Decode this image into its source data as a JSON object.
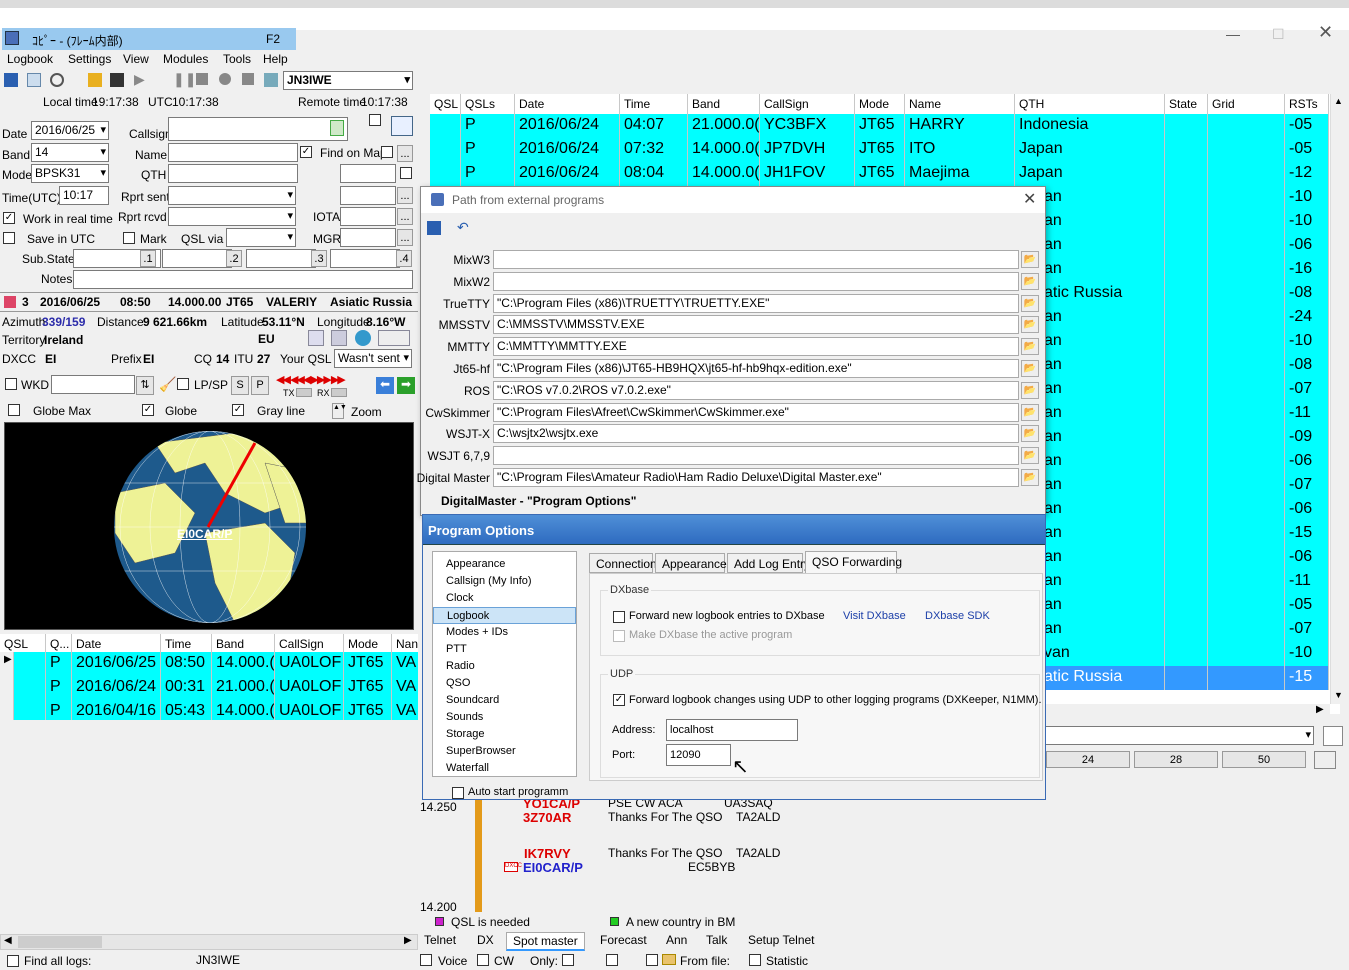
{
  "window": {
    "title_jp": "ｺﾋﾟｰ - (ﾌﾚｰﾑ内部)",
    "hotkey": "F2"
  },
  "menu": [
    "Logbook",
    "Settings",
    "View",
    "Modules",
    "Tools",
    "Help"
  ],
  "toolbar": {
    "callsign": "JN3IWE"
  },
  "time": {
    "local_label": "Local time",
    "local": "19:17:38",
    "utc_label": "UTC",
    "utc": "10:17:38",
    "remote_label": "Remote time",
    "remote": "10:17:38"
  },
  "form": {
    "date_label": "Date",
    "date": "2016/06/25",
    "band_label": "Band",
    "band": "14",
    "mode_label": "Mode",
    "mode": "BPSK31",
    "time_label": "Time(UTC)",
    "time": "10:17",
    "work_realtime": "Work in real time",
    "save_utc": "Save in UTC",
    "substate": "Sub.State:",
    "notes": "Notes",
    "callsign_label": "Callsign",
    "name_label": "Name",
    "qth_label": "QTH",
    "rprt_sent": "Rprt sent",
    "rprt_rcvd": "Rprt rcvd",
    "mark": "Mark",
    "qsl_via": "QSL via",
    "find_on_map": "Find on Map",
    "grid": "Grid",
    "state": "State",
    "iota": "IOTA",
    "mgr": "MGR",
    "sub_buttons": [
      ".1",
      ".2",
      ".3",
      ".4"
    ]
  },
  "info": {
    "count": "3",
    "date": "2016/06/25",
    "time": "08:50",
    "freq": "14.000.00",
    "mode": "JT65",
    "name": "VALERIY",
    "region": "Asiatic Russia",
    "azimuth_label": "Azimuth",
    "azimuth": "339/159",
    "distance_label": "Distance",
    "distance": "9 621.66km",
    "latitude_label": "Latitude",
    "latitude": "53.11°N",
    "longitude_label": "Longitude",
    "longitude": "8.16°W",
    "territory_label": "Territory",
    "territory": "Ireland",
    "continent": "EU",
    "dxcc_label": "DXCC",
    "dxcc": "EI",
    "prefix_label": "Prefix",
    "prefix": "EI",
    "cq_label": "CQ",
    "cq": "14",
    "itu_label": "ITU",
    "itu": "27",
    "your_qsl_label": "Your QSL",
    "your_qsl": "Wasn't sent"
  },
  "wkd": {
    "label": "WKD",
    "lpsp": "LP/SP",
    "s": "S",
    "p": "P",
    "tx": "TX",
    "rx": "RX"
  },
  "globe": {
    "globe_max": "Globe Max",
    "globe": "Globe",
    "grayline": "Gray line",
    "zoom": "Zoom",
    "station": "EI0CAR/P"
  },
  "bottom_grid": {
    "headers": [
      "QSL",
      "Q...",
      "Date",
      "Time",
      "Band",
      "CallSign",
      "Mode",
      "Nan"
    ],
    "rows": [
      [
        "P",
        "2016/06/25",
        "08:50",
        "14.000.(",
        "UA0LOF",
        "JT65",
        "VA"
      ],
      [
        "P",
        "2016/06/24",
        "00:31",
        "21.000.(",
        "UA0LOF",
        "JT65",
        "VA"
      ],
      [
        "P",
        "2016/04/16",
        "05:43",
        "14.000.(",
        "UA0LOF",
        "JT65",
        "VA"
      ]
    ]
  },
  "main_grid": {
    "headers": [
      "QSL",
      "QSLs",
      "Date",
      "Time",
      "Band",
      "CallSign",
      "Mode",
      "Name",
      "QTH",
      "State",
      "Grid",
      "RSTs"
    ],
    "rows": [
      [
        "P",
        "2016/06/24",
        "04:07",
        "21.000.0(",
        "YC3BFX",
        "JT65",
        "HARRY",
        "Indonesia",
        "-05"
      ],
      [
        "P",
        "2016/06/24",
        "07:32",
        "14.000.0(",
        "JP7DVH",
        "JT65",
        "ITO",
        "Japan",
        "-05"
      ],
      [
        "P",
        "2016/06/24",
        "08:04",
        "14.000.0(",
        "JH1FOV",
        "JT65",
        "Maejima",
        "Japan",
        "-12"
      ]
    ],
    "tail_qth": [
      "an",
      "an",
      "an",
      "an",
      "atic Russia",
      "an",
      "an",
      "an",
      "an",
      "an",
      "an",
      "an",
      "an",
      "an",
      "an",
      "an",
      "an",
      "an",
      "an",
      "van",
      "atic Russia"
    ],
    "tail_rst": [
      "-10",
      "-10",
      "-06",
      "-16",
      "-08",
      "-24",
      "-10",
      "-08",
      "-07",
      "-11",
      "-09",
      "-06",
      "-07",
      "-06",
      "-15",
      "-06",
      "-11",
      "-05",
      "-07",
      "-10",
      "-15"
    ]
  },
  "paths": {
    "title": "Path from external programs",
    "items": [
      {
        "label": "MixW3",
        "value": ""
      },
      {
        "label": "MixW2",
        "value": ""
      },
      {
        "label": "TrueTTY",
        "value": "\"C:\\Program Files (x86)\\TRUETTY\\TRUETTY.EXE\""
      },
      {
        "label": "MMSSTV",
        "value": "C:\\MMSSTV\\MMSSTV.EXE"
      },
      {
        "label": "MMTTY",
        "value": "C:\\MMTTY\\MMTTY.EXE"
      },
      {
        "label": "Jt65-hf",
        "value": "\"C:\\Program Files (x86)\\JT65-HB9HQX\\jt65-hf-hb9hqx-edition.exe\""
      },
      {
        "label": "ROS",
        "value": "\"C:\\ROS v7.0.2\\ROS v7.0.2.exe\""
      },
      {
        "label": "CwSkimmer",
        "value": "\"C:\\Program Files\\Afreet\\CwSkimmer\\CwSkimmer.exe\""
      },
      {
        "label": "WSJT-X",
        "value": "C:\\wsjtx2\\wsjtx.exe"
      },
      {
        "label": "WSJT 6,7,9",
        "value": ""
      },
      {
        "label": "Digital Master",
        "value": "\"C:\\Program Files\\Amateur Radio\\Ham Radio Deluxe\\Digital Master.exe\""
      }
    ],
    "dm_caption": "DigitalMaster - \"Program Options\""
  },
  "options": {
    "title": "Program Options",
    "list": [
      "Appearance",
      "Callsign (My Info)",
      "Clock",
      "Logbook",
      "Modes + IDs",
      "PTT",
      "Radio",
      "QSO",
      "Soundcard",
      "Sounds",
      "Storage",
      "SuperBrowser",
      "Waterfall"
    ],
    "selected": "Logbook",
    "tabs": [
      "Connection",
      "Appearance",
      "Add Log Entry",
      "QSO Forwarding"
    ],
    "dxbase_group": "DXbase",
    "forward_dxbase": "Forward new logbook entries to DXbase",
    "visit_dxbase": "Visit DXbase",
    "dxbase_sdk": "DXbase SDK",
    "make_active": "Make DXbase the active program",
    "udp_group": "UDP",
    "forward_udp": "Forward logbook changes using UDP to other logging programs (DXKeeper, N1MM).",
    "address_label": "Address:",
    "address": "localhost",
    "port_label": "Port:",
    "port": "12090",
    "auto_start": "Auto start programm"
  },
  "spots": {
    "freq_top": "14.250",
    "freq_bottom": "14.200",
    "lines": [
      {
        "call": "YO1CA/P",
        "text": "PSE CW ACA",
        "extra": "UA3SAQ"
      },
      {
        "call": "3Z70AR",
        "text": "Thanks For The QSO",
        "extra": "TA2ALD"
      },
      {
        "call": "IK7RVY",
        "text": "Thanks For The QSO",
        "extra": "TA2ALD"
      },
      {
        "call": "EI0CAR/P",
        "text": "",
        "extra": "EC5BYB"
      }
    ],
    "legend_qsl": "QSL is needed",
    "legend_new": "A new country in BM",
    "scale": [
      "24",
      "28",
      "50"
    ]
  },
  "bottom_tabs": [
    "Telnet",
    "DX",
    "Spot master",
    "Forecast",
    "Ann",
    "Talk",
    "Setup Telnet"
  ],
  "status": {
    "find_all": "Find all logs:",
    "call": "JN3IWE",
    "voice": "Voice",
    "cw": "CW",
    "only": "Only:",
    "from_file": "From file:",
    "statistic": "Statistic"
  }
}
